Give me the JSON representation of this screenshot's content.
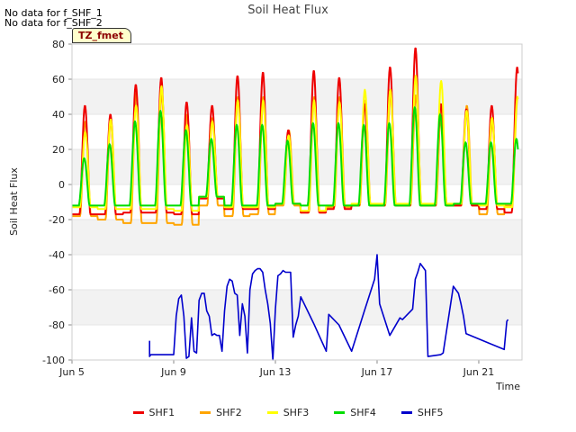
{
  "notes": [
    "No data for f_SHF_1",
    "No data for f_SHF_2"
  ],
  "badge": "TZ_fmet",
  "chart_data": {
    "type": "line",
    "title": "Soil Heat Flux",
    "xlabel": "Time",
    "ylabel": "Soil Heat Flux",
    "xlim": [
      5.0,
      22.7
    ],
    "ylim": [
      -100,
      80
    ],
    "x_ticks": [
      5,
      9,
      13,
      17,
      21
    ],
    "x_tick_labels": [
      "Jun 5",
      "Jun 9",
      "Jun 13",
      "Jun 17",
      "Jun 21"
    ],
    "y_ticks": [
      -100,
      -80,
      -60,
      -40,
      -20,
      0,
      20,
      40,
      60,
      80
    ],
    "grid": "horizontal bands",
    "legend_position": "bottom",
    "x_units": "day of June",
    "daily_series": {
      "days": [
        5,
        6,
        7,
        8,
        9,
        10,
        11,
        12,
        13,
        14,
        15,
        16,
        17,
        18,
        19,
        20,
        21,
        22
      ],
      "SHF1_peak": [
        45,
        40,
        57,
        61,
        47,
        45,
        62,
        64,
        31,
        65,
        61,
        46,
        67,
        78,
        46,
        43,
        45,
        67
      ],
      "SHF2_peak": [
        36,
        38,
        52,
        52,
        40,
        38,
        50,
        50,
        31,
        50,
        50,
        48,
        51,
        51,
        45,
        45,
        35,
        50
      ],
      "SHF3_peak": [
        30,
        37,
        45,
        56,
        34,
        36,
        48,
        48,
        28,
        48,
        47,
        54,
        54,
        62,
        59,
        42,
        38,
        50
      ],
      "SHF4_peak": [
        15,
        23,
        36,
        42,
        31,
        26,
        34,
        34,
        25,
        35,
        35,
        34,
        35,
        44,
        40,
        24,
        24,
        26
      ],
      "SHF1_min": [
        -17,
        -17,
        -16,
        -16,
        -17,
        -8,
        -14,
        -14,
        -11,
        -16,
        -14,
        -12,
        -12,
        -12,
        -12,
        -12,
        -14,
        -16
      ],
      "SHF2_min": [
        -18,
        -20,
        -22,
        -22,
        -23,
        -12,
        -18,
        -17,
        -12,
        -16,
        -13,
        -12,
        -12,
        -12,
        -12,
        -12,
        -17,
        -12
      ],
      "SHF3_min": [
        -13,
        -14,
        -14,
        -14,
        -15,
        -7,
        -13,
        -13,
        -11,
        -15,
        -12,
        -11,
        -11,
        -11,
        -11,
        -11,
        -12,
        -13
      ],
      "SHF4_min": [
        -12,
        -12,
        -12,
        -12,
        -12,
        -7,
        -12,
        -12,
        -11,
        -12,
        -12,
        -12,
        -12,
        -12,
        -12,
        -11,
        -11,
        -11
      ]
    },
    "series": [
      {
        "name": "SHF1",
        "color": "#ee0000"
      },
      {
        "name": "SHF2",
        "color": "#ffa500"
      },
      {
        "name": "SHF3",
        "color": "#ffff00"
      },
      {
        "name": "SHF4",
        "color": "#00dd00"
      },
      {
        "name": "SHF5",
        "color": "#0000cc",
        "x": [
          8.05,
          8.05,
          8.1,
          8.2,
          9.0,
          9.1,
          9.2,
          9.3,
          9.4,
          9.5,
          9.6,
          9.7,
          9.8,
          9.9,
          10.0,
          10.1,
          10.2,
          10.3,
          10.4,
          10.5,
          10.6,
          10.7,
          10.8,
          10.9,
          11.0,
          11.1,
          11.2,
          11.3,
          11.4,
          11.5,
          11.6,
          11.7,
          11.8,
          11.9,
          12.0,
          12.1,
          12.2,
          12.3,
          12.4,
          12.5,
          12.6,
          12.7,
          12.8,
          12.9,
          13.0,
          13.1,
          13.2,
          13.3,
          13.4,
          13.5,
          13.6,
          13.7,
          13.8,
          13.9,
          14.0,
          14.5,
          15.0,
          15.1,
          15.5,
          16.0,
          16.5,
          16.9,
          17.0,
          17.1,
          17.5,
          17.9,
          18.0,
          18.4,
          18.5,
          18.6,
          18.7,
          18.9,
          19.0,
          19.5,
          19.6,
          20.0,
          20.2,
          20.3,
          20.4,
          20.5,
          22.0,
          22.1,
          22.15
        ],
        "y": [
          -89,
          -98,
          -97,
          -97,
          -97,
          -75,
          -65,
          -63,
          -75,
          -99,
          -98,
          -76,
          -95,
          -96,
          -66,
          -62,
          -62,
          -72,
          -75,
          -86,
          -85,
          -86,
          -86,
          -95,
          -72,
          -58,
          -54,
          -55,
          -62,
          -63,
          -86,
          -68,
          -75,
          -96,
          -60,
          -51,
          -49,
          -48,
          -48,
          -50,
          -60,
          -68,
          -79,
          -100,
          -71,
          -52,
          -51,
          -49,
          -50,
          -50,
          -50,
          -87,
          -80,
          -75,
          -64,
          -79,
          -95,
          -74,
          -80,
          -95,
          -72,
          -54,
          -40,
          -68,
          -86,
          -76,
          -77,
          -71,
          -54,
          -50,
          -45,
          -49,
          -98,
          -97,
          -96,
          -58,
          -62,
          -68,
          -75,
          -85,
          -94,
          -78,
          -77
        ]
      }
    ]
  },
  "legend": [
    {
      "label": "SHF1",
      "color": "#ee0000"
    },
    {
      "label": "SHF2",
      "color": "#ffa500"
    },
    {
      "label": "SHF3",
      "color": "#ffff00"
    },
    {
      "label": "SHF4",
      "color": "#00dd00"
    },
    {
      "label": "SHF5",
      "color": "#0000cc"
    }
  ]
}
